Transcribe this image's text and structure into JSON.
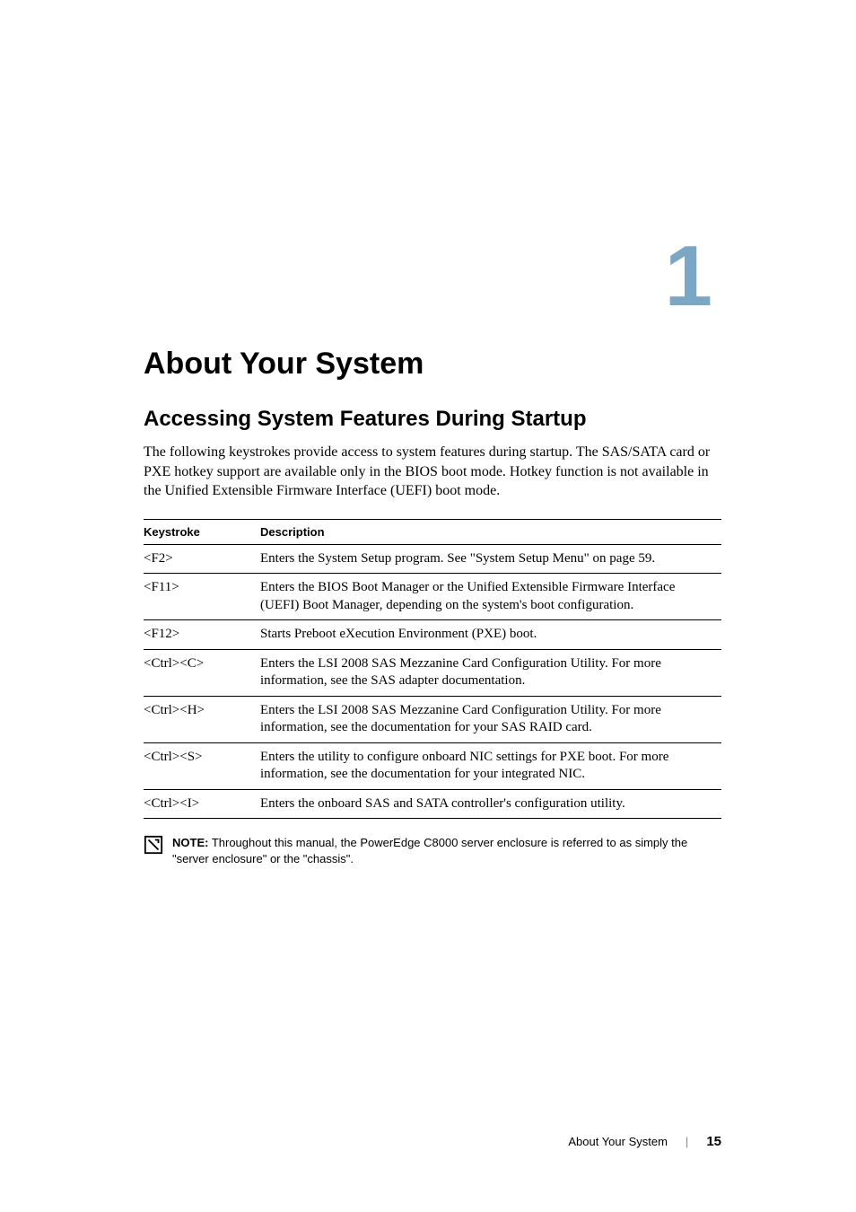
{
  "chapter": {
    "number": "1",
    "title": "About Your System"
  },
  "section": {
    "title": "Accessing System Features During Startup",
    "intro": "The following keystrokes provide access to system features during startup. The SAS/SATA card or PXE hotkey support are available only in the BIOS boot mode. Hotkey function is not available in the Unified Extensible Firmware Interface (UEFI) boot mode."
  },
  "table": {
    "headers": {
      "keystroke": "Keystroke",
      "description": "Description"
    },
    "rows": [
      {
        "key": "<F2>",
        "desc": "Enters the System Setup program. See \"System Setup Menu\" on page 59."
      },
      {
        "key": "<F11>",
        "desc": "Enters the BIOS Boot Manager or the Unified Extensible Firmware Interface (UEFI) Boot Manager, depending on the system's boot configuration."
      },
      {
        "key": "<F12>",
        "desc": "Starts Preboot eXecution Environment (PXE) boot."
      },
      {
        "key": "<Ctrl><C>",
        "desc": "Enters the LSI 2008 SAS Mezzanine Card Configuration Utility. For more information, see the SAS adapter documentation."
      },
      {
        "key": "<Ctrl><H>",
        "desc": "Enters the LSI 2008 SAS Mezzanine Card Configuration Utility. For more information, see the documentation for your SAS RAID card."
      },
      {
        "key": "<Ctrl><S>",
        "desc": "Enters the utility to configure onboard NIC settings for PXE boot. For more information, see the documentation for your integrated NIC."
      },
      {
        "key": "<Ctrl><I>",
        "desc": "Enters the onboard SAS and SATA controller's configuration utility."
      }
    ]
  },
  "note": {
    "label": "NOTE:",
    "text": " Throughout this manual, the PowerEdge C8000 server enclosure is referred to as simply the \"server enclosure\" or the \"chassis\"."
  },
  "footer": {
    "section_name": "About Your System",
    "page_number": "15"
  }
}
